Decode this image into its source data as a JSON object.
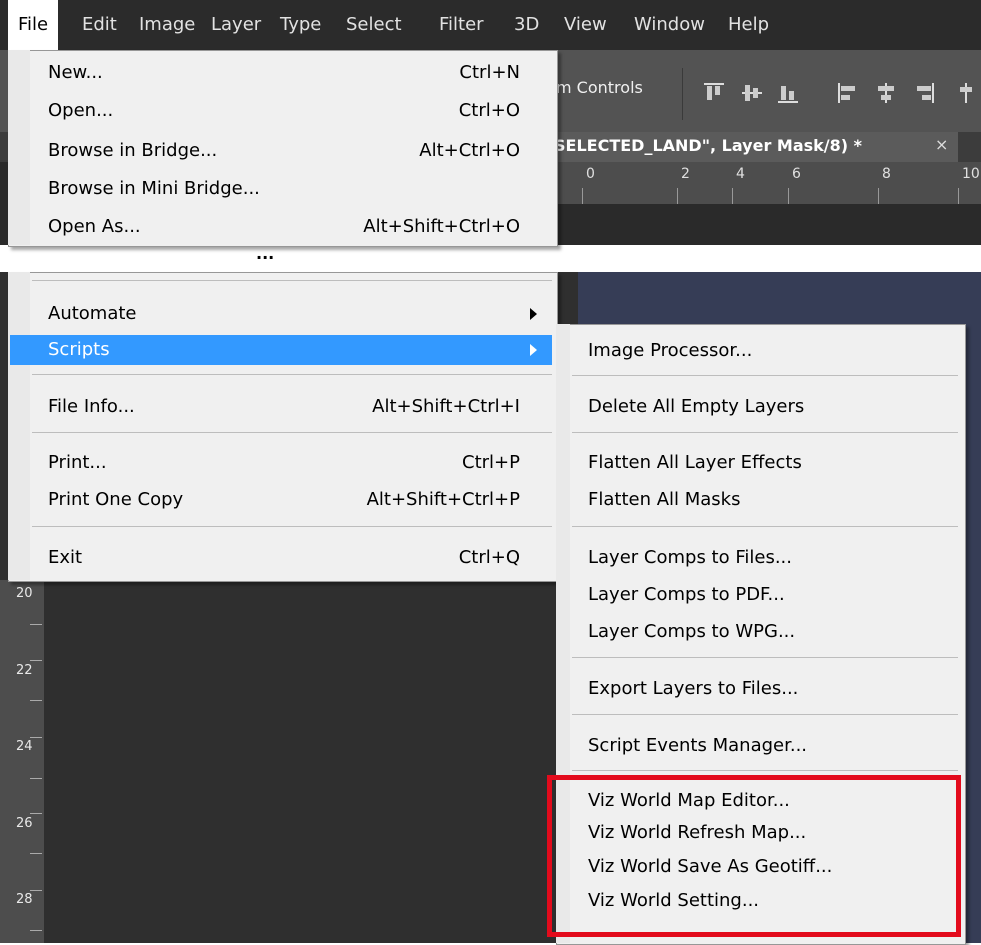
{
  "menubar": {
    "items": [
      "File",
      "Edit",
      "Image",
      "Layer",
      "Type",
      "Select",
      "Filter",
      "3D",
      "View",
      "Window",
      "Help"
    ],
    "active": "File"
  },
  "options_bar": {
    "transform_controls_label": "m Controls"
  },
  "document_tab": {
    "title": "SELECTED_LAND\", Layer Mask/8) *",
    "close": "×"
  },
  "horizontal_ruler": {
    "labels": [
      "0",
      "2",
      "4",
      "6",
      "8",
      "10"
    ]
  },
  "vertical_ruler": {
    "labels": [
      "20",
      "22",
      "24",
      "26",
      "28"
    ]
  },
  "file_menu": {
    "items": [
      {
        "label": "New...",
        "shortcut": "Ctrl+N"
      },
      {
        "label": "Open...",
        "shortcut": "Ctrl+O"
      },
      {
        "label": "Browse in Bridge...",
        "shortcut": "Alt+Ctrl+O"
      },
      {
        "label": "Browse in Mini Bridge...",
        "shortcut": ""
      },
      {
        "label": "Open As...",
        "shortcut": "Alt+Shift+Ctrl+O"
      }
    ],
    "omitted_marker": "...",
    "items_after": [
      {
        "label": "Automate",
        "shortcut": "",
        "submenu": true
      },
      {
        "label": "Scripts",
        "shortcut": "",
        "submenu": true,
        "selected": true
      },
      {
        "label": "File Info...",
        "shortcut": "Alt+Shift+Ctrl+I"
      },
      {
        "label": "Print...",
        "shortcut": "Ctrl+P"
      },
      {
        "label": "Print One Copy",
        "shortcut": "Alt+Shift+Ctrl+P"
      },
      {
        "label": "Exit",
        "shortcut": "Ctrl+Q"
      }
    ]
  },
  "scripts_menu": {
    "items": [
      "Image Processor...",
      "Delete All Empty Layers",
      "Flatten All Layer Effects",
      "Flatten All Masks",
      "Layer Comps to Files...",
      "Layer Comps to PDF...",
      "Layer Comps to WPG...",
      "Export Layers to Files...",
      "Script Events Manager...",
      "Viz World Map Editor...",
      "Viz World Refresh Map...",
      "Viz World Save As Geotiff...",
      "Viz World Setting..."
    ]
  },
  "colors": {
    "selection": "#3399ff",
    "highlight_box": "#e30b1c",
    "menu_bg": "#f0f0f0",
    "app_dark": "#2b2b2b"
  }
}
